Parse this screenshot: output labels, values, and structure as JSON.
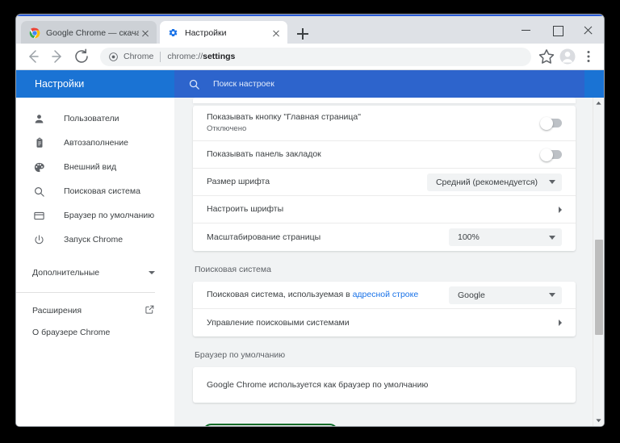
{
  "window": {
    "controls": {
      "minimize": "minimize-button",
      "maximize": "maximize-button",
      "close": "close-button"
    }
  },
  "tabs": [
    {
      "title": "Google Chrome — скачать бесп",
      "favicon": "chrome-logo-icon",
      "active": false
    },
    {
      "title": "Настройки",
      "favicon": "gear-icon",
      "active": true
    }
  ],
  "new_tab_label": "+",
  "toolbar": {
    "back": "back-arrow-icon",
    "forward": "forward-arrow-icon",
    "reload": "reload-icon",
    "omnibox": {
      "site_label": "Chrome",
      "url_prefix": "chrome://",
      "url_page": "settings",
      "lock_icon": "chrome-page-icon"
    },
    "bookmark": "star-icon",
    "profile": "avatar-icon",
    "menu": "three-dot-menu-icon"
  },
  "settings_header": {
    "title": "Настройки",
    "search_placeholder": "Поиск настроек",
    "search_icon": "search-icon",
    "background": "#1a73d4"
  },
  "sidebar": {
    "items": [
      {
        "label": "Пользователи",
        "icon": "person-icon"
      },
      {
        "label": "Автозаполнение",
        "icon": "clipboard-icon"
      },
      {
        "label": "Внешний вид",
        "icon": "palette-icon"
      },
      {
        "label": "Поисковая система",
        "icon": "search-icon"
      },
      {
        "label": "Браузер по умолчанию",
        "icon": "window-icon"
      },
      {
        "label": "Запуск Chrome",
        "icon": "power-icon"
      }
    ],
    "advanced": {
      "label": "Дополнительные",
      "icon": "chevron-down-icon"
    },
    "footer_items": [
      {
        "label": "Расширения",
        "icon": "external-link-icon"
      },
      {
        "label": "О браузере Chrome",
        "icon": ""
      }
    ]
  },
  "content": {
    "appearance_rows": [
      {
        "label": "Показывать кнопку \"Главная страница\"",
        "sublabel": "Отключено",
        "control": "toggle",
        "toggle_on": false
      },
      {
        "label": "Показывать панель закладок",
        "sublabel": "",
        "control": "toggle",
        "toggle_on": false
      },
      {
        "label": "Размер шрифта",
        "sublabel": "",
        "control": "dropdown",
        "value": "Средний (рекомендуется)"
      },
      {
        "label": "Настроить шрифты",
        "sublabel": "",
        "control": "chevron"
      },
      {
        "label": "Масштабирование страницы",
        "sublabel": "",
        "control": "dropdown",
        "value": "100%"
      }
    ],
    "search_section": {
      "title": "Поисковая система",
      "row1": {
        "label_pre": "Поисковая система, используемая в ",
        "label_link": "адресной строке",
        "value": "Google"
      },
      "row2": {
        "label": "Управление поисковыми системами",
        "highlighted": true,
        "highlight_color": "#0b6b27"
      }
    },
    "default_browser_section": {
      "title": "Браузер по умолчанию",
      "row_label": "Google Chrome используется как браузер по умолчанию"
    }
  },
  "scrollbar": {
    "up_arrow": "scroll-up-arrow-icon",
    "down_arrow": "scroll-down-arrow-icon",
    "thumb": "scrollbar-thumb"
  }
}
